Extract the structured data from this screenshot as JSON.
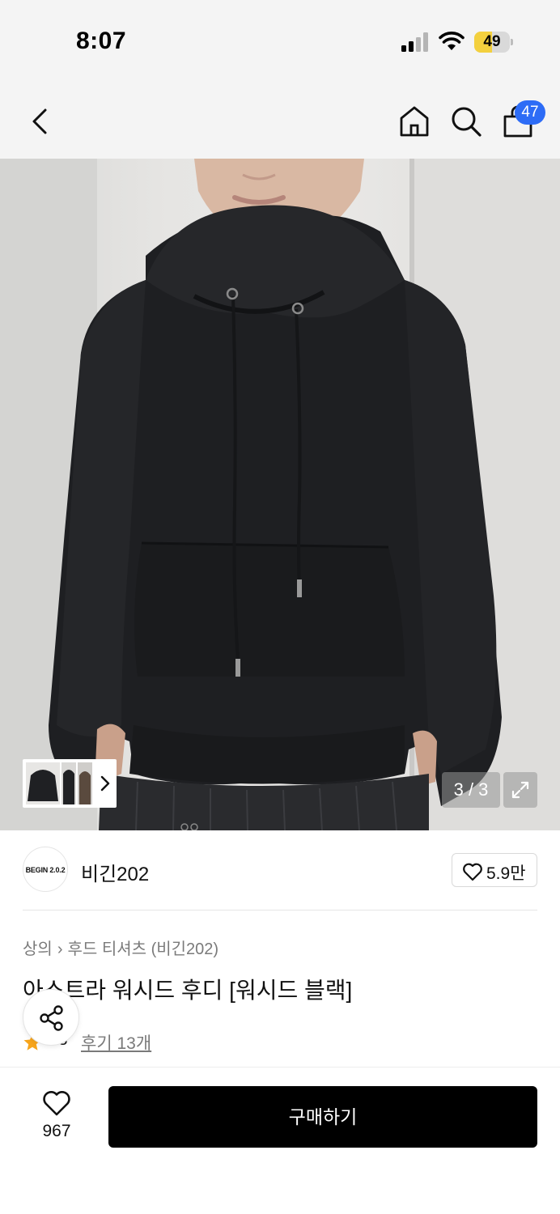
{
  "status_bar": {
    "time": "8:07",
    "battery_percent": "49",
    "battery_level": 0.49,
    "battery_color": "#f3d03e"
  },
  "nav": {
    "cart_count": "47",
    "badge_color": "#2d6cf6",
    "icons": [
      "back-icon",
      "home-icon",
      "search-icon",
      "bag-icon"
    ]
  },
  "gallery": {
    "counter": "3 / 3",
    "thumbnail_strip_icon": "chevron-right-icon",
    "expand_icon": "expand-icon"
  },
  "brand": {
    "logo_text": "BEGIN 2.0.2",
    "name": "비긴202",
    "likes": "5.9만"
  },
  "breadcrumb": {
    "category": "상의",
    "subcategory": "후드 티셔츠 (비긴202)"
  },
  "product": {
    "title": "아스트라 워시드 후디 [워시드 블랙]",
    "rating": "4.8",
    "rating_visible": ".8",
    "reviews": "후기 13개",
    "star_color": "#f7a51c"
  },
  "bottom_bar": {
    "wish_count": "967",
    "buy_label": "구매하기"
  }
}
